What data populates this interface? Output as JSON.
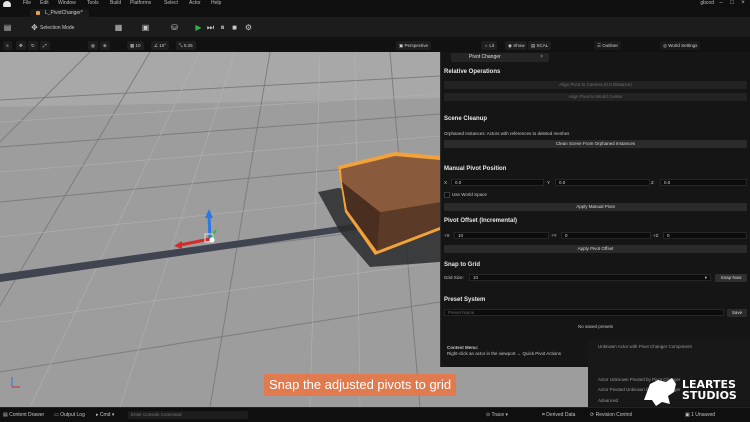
{
  "menubar": {
    "items": [
      "File",
      "Edit",
      "Window",
      "Tools",
      "Build",
      "Platforms",
      "Select",
      "Actor",
      "Help"
    ],
    "account": "gbcod"
  },
  "level_tab": "L_PivotChanger*",
  "toolbar": {
    "selection_mode": "Selection Mode"
  },
  "viewport_bar": {
    "snap_value_1": "10",
    "snap_value_2": "10°",
    "snap_value_3": "0.25",
    "perspective": "Perspective",
    "lit": "Lit",
    "show": "Show",
    "scalability": "SCAL",
    "outliner": "Outliner",
    "world_settings": "World Settings"
  },
  "panel": {
    "tab_label": "Pivot Changer",
    "relative_operations": {
      "title": "Relative Operations",
      "btn1": "Align Pivot to Camera (0.0 Distance)",
      "btn2": "Align Pivot to World Center"
    },
    "scene_cleanup": {
      "title": "Scene Cleanup",
      "desc": "Orphaned Instances: Actors with references to deleted meshes",
      "btn": "Clean Scene From Orphaned Instances"
    },
    "manual_pivot": {
      "title": "Manual Pivot Position",
      "x_label": "X",
      "x_value": "0.0",
      "y_label": "Y",
      "y_value": "0.0",
      "z_label": "Z",
      "z_value": "0.0",
      "world_space_label": "Use World Space",
      "apply": "Apply Manual Pivot"
    },
    "pivot_offset": {
      "title": "Pivot Offset (Incremental)",
      "x_label": "+X",
      "x_value": "10",
      "y_label": "+Y",
      "y_value": "0",
      "z_label": "+Z",
      "z_value": "0",
      "apply": "Apply Pivot Offset"
    },
    "snap_to_grid": {
      "title": "Snap to Grid",
      "grid_size_label": "Grid Size:",
      "grid_size_value": "10",
      "snap_btn": "Snap Now"
    },
    "preset_system": {
      "title": "Preset System",
      "name_placeholder": "Preset Name",
      "save": "Save",
      "empty": "No saved presets"
    },
    "context_menu": {
      "title": "Context Menu:",
      "text": "Right-click an actor in the viewport → Quick Pivot Actions"
    }
  },
  "details_behind": {
    "row1": "Unknown Actor with Pivot Changer Component",
    "row2": "Actor Unknown Pivoted by Pivot Changer",
    "row3": "Actor Pivoted Unknown by Pivot Changer",
    "advanced": "Advanced"
  },
  "statusbar": {
    "content_drawer": "Content Drawer",
    "output_log": "Output Log",
    "cmd": "Cmd",
    "cmd_placeholder": "Enter Console Command",
    "trace": "Trace",
    "derived_data": "Derived Data",
    "revision": "Revision Control",
    "unsaved": "1 Unsaved",
    "source": "Revision Control"
  },
  "subtitle": "Snap the adjusted pivots to grid",
  "watermark": {
    "line1": "LEARTES",
    "line2": "STUDIOS"
  },
  "colors": {
    "accent_orange": "#e07a4f",
    "selection_outline": "#f2a23a",
    "panel_bg": "#151515"
  }
}
